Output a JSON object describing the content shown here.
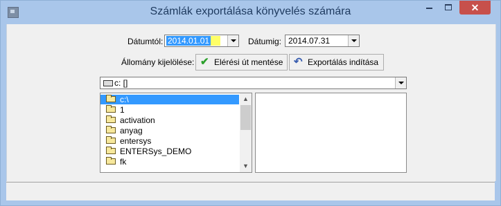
{
  "window": {
    "title": "Számlák exportálása könyvelés számára",
    "close_glyph": "✕"
  },
  "date_filter": {
    "from_label": "Dátumtól:",
    "from_value": "2014.01.01",
    "to_label": "Dátumig:",
    "to_value": "2014.07.31"
  },
  "file_selection": {
    "label": "Állomány kijelölése:",
    "save_path_label": "Elérési út mentése",
    "save_path_icon": "checkmark-icon",
    "export_label": "Exportálás indítása",
    "export_icon": "undo-arrow-icon"
  },
  "drive": {
    "value": "c: []"
  },
  "directories": {
    "items": [
      {
        "name": "c:\\",
        "selected": true,
        "open": true
      },
      {
        "name": "1"
      },
      {
        "name": "activation"
      },
      {
        "name": "anyag"
      },
      {
        "name": "entersys"
      },
      {
        "name": "ENTERSys_DEMO"
      },
      {
        "name": "fk"
      }
    ]
  },
  "colors": {
    "titlebar": "#a9c6ea",
    "close_button": "#c7504b",
    "selection": "#3399ff",
    "checkmark": "#2ca02c"
  }
}
